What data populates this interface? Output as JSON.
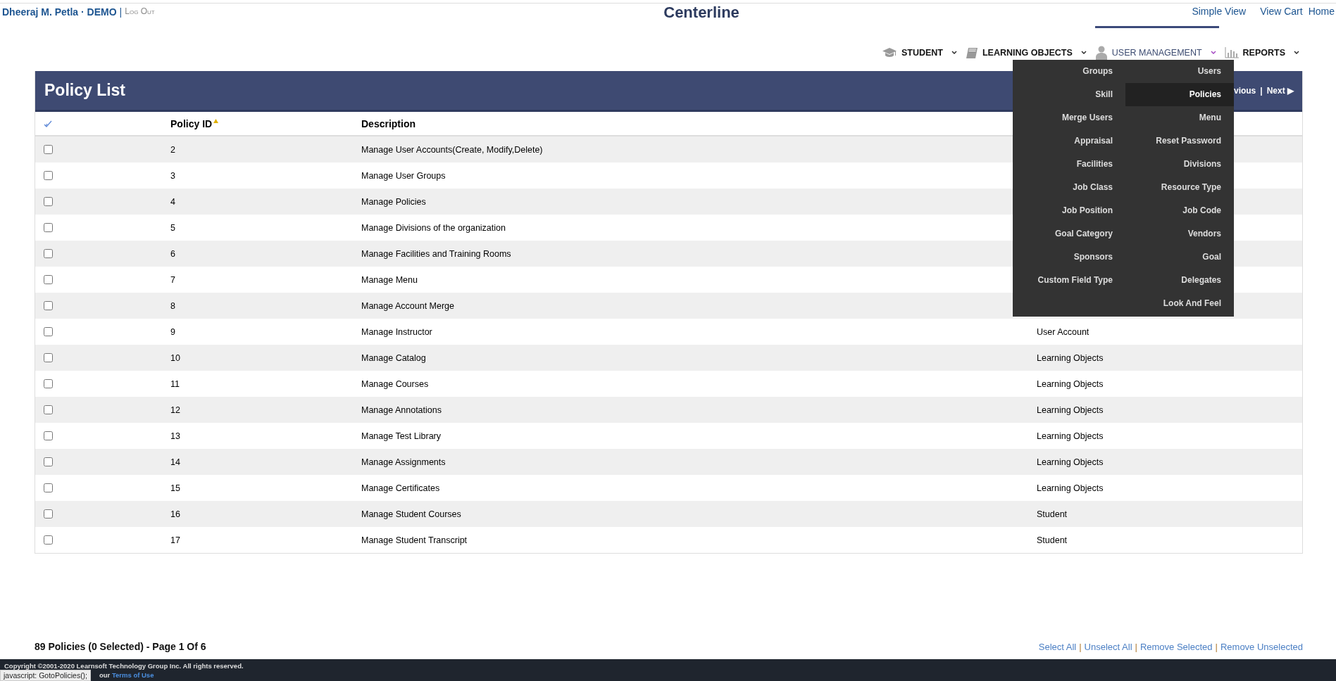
{
  "user": {
    "name": "Dheeraj M. Petla · DEMO",
    "separator": "|",
    "logout": "Log Out"
  },
  "app_title": "Centerline",
  "top_links": [
    "Simple View",
    "View Cart",
    "Home"
  ],
  "nav": [
    {
      "label": "STUDENT",
      "expanded": false
    },
    {
      "label": "LEARNING OBJECTS",
      "expanded": false
    },
    {
      "label": "USER MANAGEMENT",
      "expanded": true
    },
    {
      "label": "REPORTS",
      "expanded": false
    }
  ],
  "dropdown": {
    "columns": [
      [
        {
          "label": "Groups",
          "selected": false
        },
        {
          "label": "Skill",
          "selected": false
        },
        {
          "label": "Merge Users",
          "selected": false
        },
        {
          "label": "Appraisal",
          "selected": false
        },
        {
          "label": "Facilities",
          "selected": false
        },
        {
          "label": "Job Class",
          "selected": false
        },
        {
          "label": "Job Position",
          "selected": false
        },
        {
          "label": "Goal Category",
          "selected": false
        },
        {
          "label": "Sponsors",
          "selected": false
        },
        {
          "label": "Custom Field Type",
          "selected": false
        }
      ],
      [
        {
          "label": "Users",
          "selected": false
        },
        {
          "label": "Policies",
          "selected": true
        },
        {
          "label": "Menu",
          "selected": false
        },
        {
          "label": "Reset Password",
          "selected": false
        },
        {
          "label": "Divisions",
          "selected": false
        },
        {
          "label": "Resource Type",
          "selected": false
        },
        {
          "label": "Job Code",
          "selected": false
        },
        {
          "label": "Vendors",
          "selected": false
        },
        {
          "label": "Goal",
          "selected": false
        },
        {
          "label": "Delegates",
          "selected": false
        },
        {
          "label": "Look And Feel",
          "selected": false
        }
      ]
    ]
  },
  "panel": {
    "title": "Policy List",
    "pager": {
      "previous": "vious",
      "separator": "|",
      "next": "Next ▶"
    }
  },
  "table": {
    "columns": [
      "Policy ID",
      "Description"
    ],
    "rows": [
      {
        "checked": false,
        "id": "2",
        "description": "Manage User Accounts(Create, Modify,Delete)"
      },
      {
        "checked": false,
        "id": "3",
        "description": "Manage User Groups"
      },
      {
        "checked": false,
        "id": "4",
        "description": "Manage Policies"
      },
      {
        "checked": false,
        "id": "5",
        "description": "Manage Divisions of the organization"
      },
      {
        "checked": false,
        "id": "6",
        "description": "Manage Facilities and Training Rooms"
      },
      {
        "checked": false,
        "id": "7",
        "description": "Manage Menu"
      },
      {
        "checked": false,
        "id": "8",
        "description": "Manage Account Merge"
      },
      {
        "checked": false,
        "id": "9",
        "description": "Manage Instructor",
        "category": "User Account"
      },
      {
        "checked": false,
        "id": "10",
        "description": "Manage Catalog",
        "category": "Learning Objects"
      },
      {
        "checked": false,
        "id": "11",
        "description": "Manage Courses",
        "category": "Learning Objects"
      },
      {
        "checked": false,
        "id": "12",
        "description": "Manage Annotations",
        "category": "Learning Objects"
      },
      {
        "checked": false,
        "id": "13",
        "description": "Manage Test Library",
        "category": "Learning Objects"
      },
      {
        "checked": false,
        "id": "14",
        "description": "Manage Assignments",
        "category": "Learning Objects"
      },
      {
        "checked": false,
        "id": "15",
        "description": "Manage Certificates",
        "category": "Learning Objects"
      },
      {
        "checked": false,
        "id": "16",
        "description": "Manage Student Courses",
        "category": "Student"
      },
      {
        "checked": false,
        "id": "17",
        "description": "Manage Student Transcript",
        "category": "Student"
      }
    ]
  },
  "summary": "89 Policies (0 Selected) - Page 1 Of 6",
  "actions": [
    {
      "kind": "link",
      "text": "Select All"
    },
    {
      "kind": "separator",
      "text": "|"
    },
    {
      "kind": "link",
      "text": "Unselect All"
    },
    {
      "kind": "separator",
      "text": "|"
    },
    {
      "kind": "link",
      "text": "Remove Selected"
    },
    {
      "kind": "separator",
      "text": "|"
    },
    {
      "kind": "link",
      "text": "Remove Unselected"
    }
  ],
  "footer": {
    "copyright": "Copyright ©2001-2020 Learnsoft Technology Group Inc. All rights reserved.",
    "prefix": "our",
    "terms": "Terms of Use"
  },
  "status_tooltip": "javascript: GotoPolicies();"
}
